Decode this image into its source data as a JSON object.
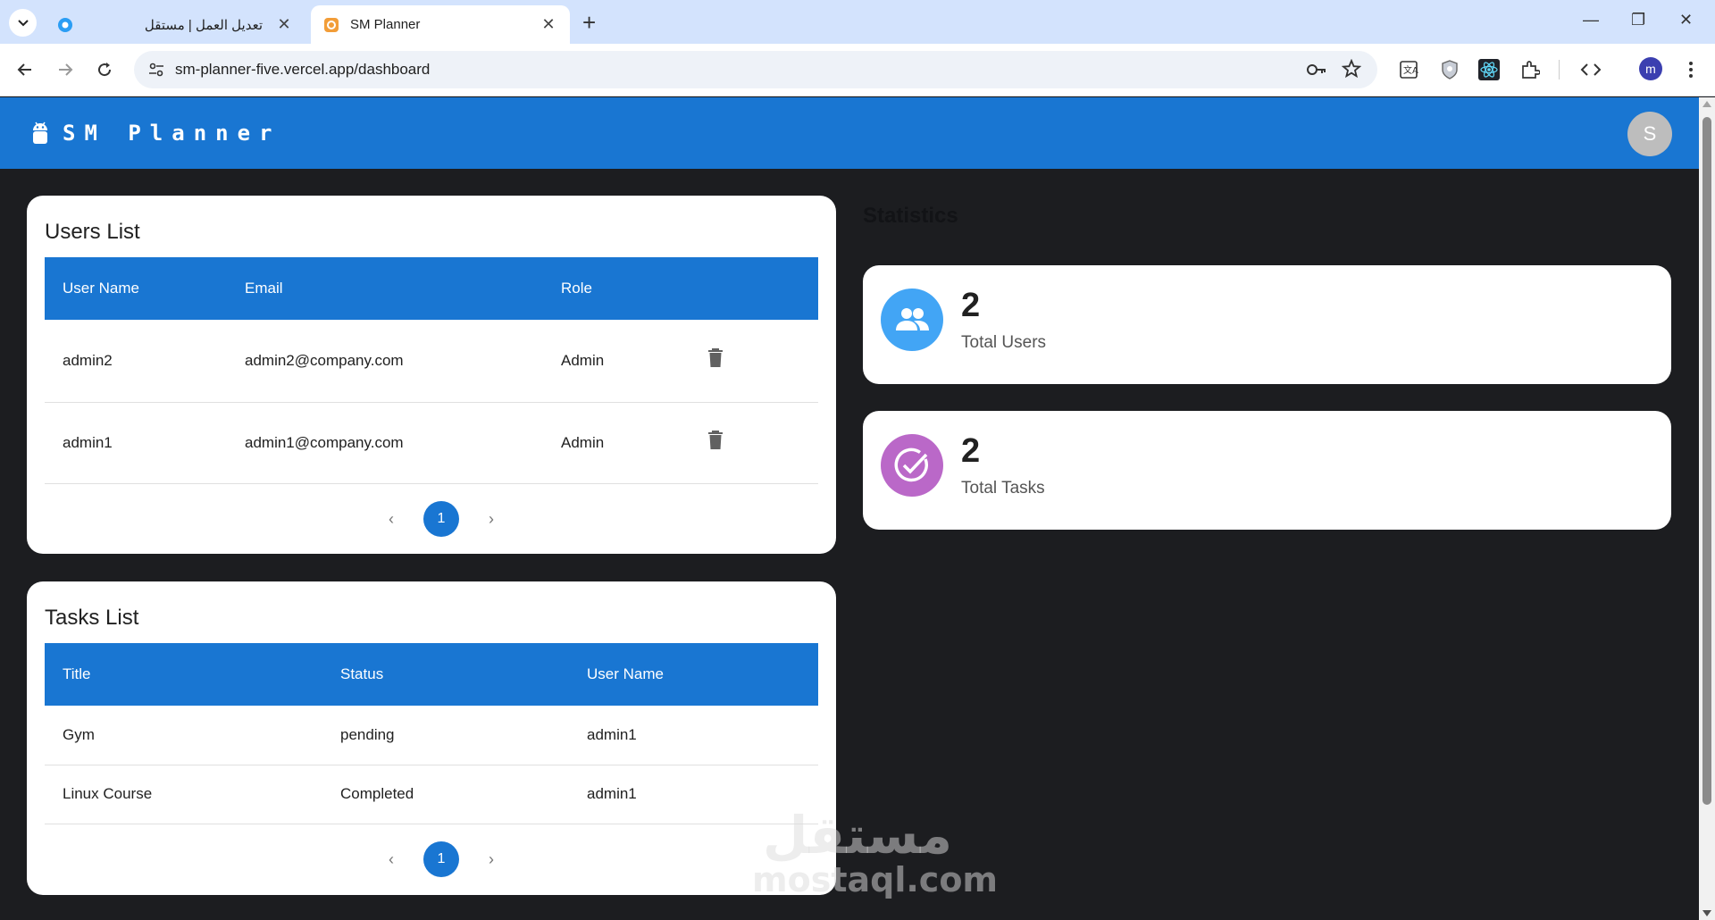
{
  "browser": {
    "tabs": [
      {
        "title": "تعديل العمل | مستقل",
        "active": false,
        "favicon": "mostaql-favicon"
      },
      {
        "title": "SM Planner",
        "active": true,
        "favicon": "sm-planner-favicon"
      }
    ],
    "url": "sm-planner-five.vercel.app/dashboard",
    "profile_initial": "m"
  },
  "app": {
    "brand": "SM Planner",
    "avatar_initial": "S",
    "primary_color": "#1976d2"
  },
  "users_list": {
    "title": "Users List",
    "columns": [
      "User Name",
      "Email",
      "Role"
    ],
    "rows": [
      {
        "user_name": "admin2",
        "email": "admin2@company.com",
        "role": "Admin"
      },
      {
        "user_name": "admin1",
        "email": "admin1@company.com",
        "role": "Admin"
      }
    ],
    "current_page": "1"
  },
  "tasks_list": {
    "title": "Tasks List",
    "columns": [
      "Title",
      "Status",
      "User Name"
    ],
    "rows": [
      {
        "title": "Gym",
        "status": "pending",
        "user_name": "admin1"
      },
      {
        "title": "Linux Course",
        "status": "Completed",
        "user_name": "admin1"
      }
    ],
    "current_page": "1"
  },
  "statistics": {
    "title": "Statistics",
    "cards": [
      {
        "value": "2",
        "label": "Total Users",
        "icon": "group-icon",
        "color": "#42a5f5"
      },
      {
        "value": "2",
        "label": "Total Tasks",
        "icon": "check-circle-icon",
        "color": "#ba68c8"
      }
    ]
  },
  "watermark": {
    "arabic": "مستقل",
    "latin": "mostaql.com"
  }
}
